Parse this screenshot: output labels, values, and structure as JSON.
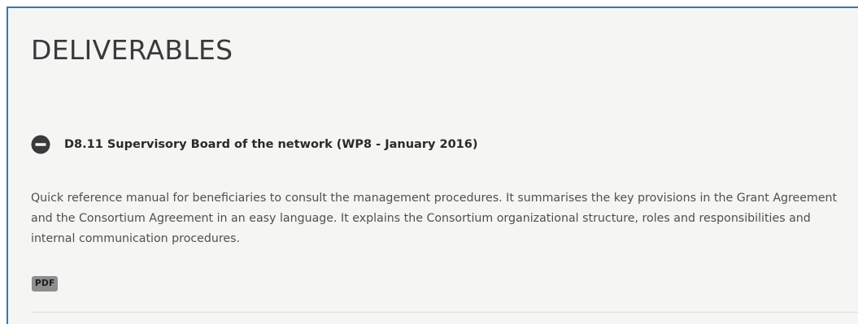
{
  "page": {
    "title": "DELIVERABLES"
  },
  "deliverables": [
    {
      "title": "D8.11 Supervisory Board of the network (WP8 - January 2016)",
      "toggle_icon": "minus-circle-icon",
      "expanded": true,
      "description": "Quick reference manual for beneficiaries to consult the management procedures. It summarises the key provisions in the Grant Agreement and the Consortium Agreement in an easy language. It explains the Consortium organizational structure, roles and responsibilities and internal communication procedures.",
      "file_label": "PDF"
    }
  ],
  "colors": {
    "panel_border": "#2e7bb8",
    "panel_background": "#f5f5f4",
    "badge_background": "#8e8e8e",
    "toggle_icon": "#3a3a3a"
  }
}
